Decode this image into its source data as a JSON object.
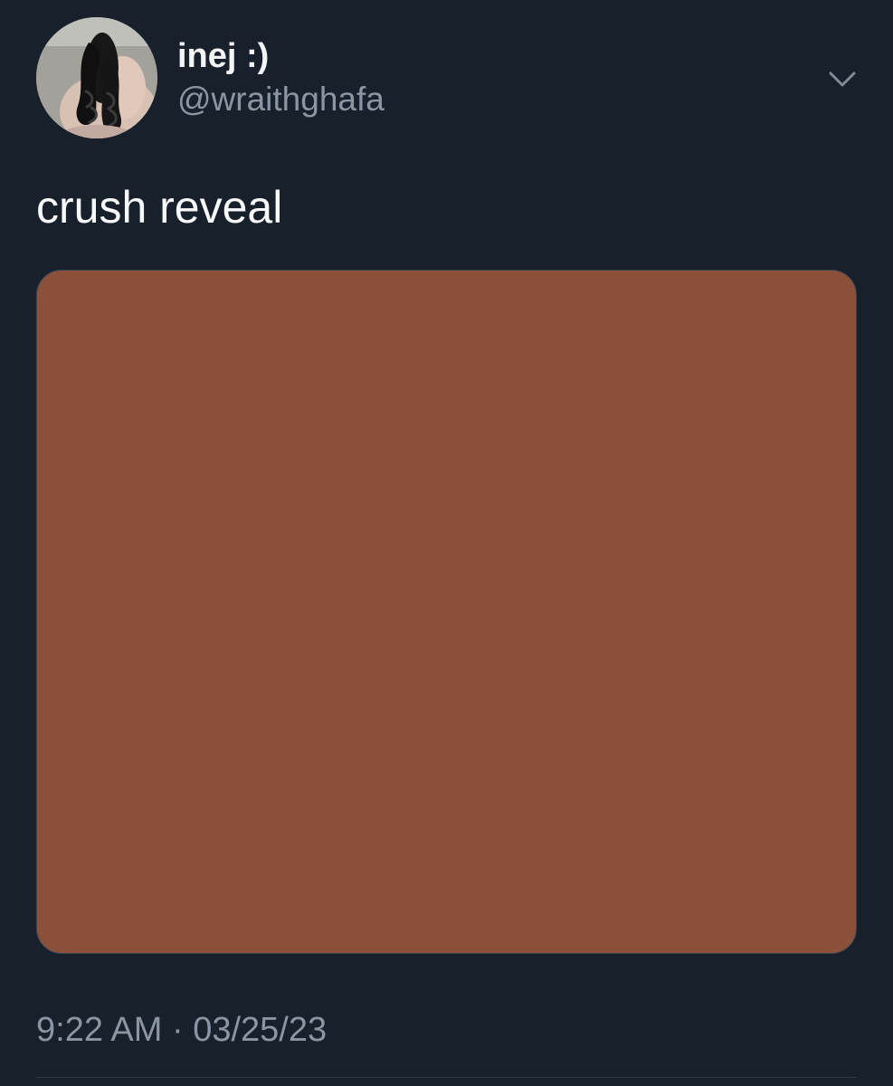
{
  "tweet": {
    "author": {
      "display_name": "inej :)",
      "handle": "@wraithghafa",
      "avatar_icon": "profile-photo"
    },
    "text": "crush reveal",
    "media": {
      "color": "#8b5039"
    },
    "timestamp": "9:22 AM · 03/25/23",
    "more_icon": "chevron-down-icon"
  },
  "theme": {
    "background": "#18202b",
    "primary_text": "#f2f4f6",
    "secondary_text": "#8a96a3"
  }
}
